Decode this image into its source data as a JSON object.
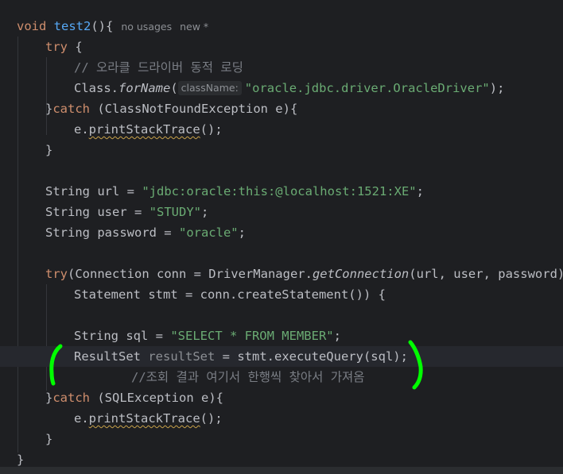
{
  "editor": {
    "method": {
      "kw": "void",
      "name": "test2",
      "rest": "(){",
      "usages": "no usages",
      "author": "new *"
    },
    "try1": {
      "kw": "try",
      "rest": " {"
    },
    "comment1": "// 오라클 드라이버 동적 로딩",
    "class_for_name": {
      "obj": "Class.",
      "method": "forName",
      "open": "(",
      "hint": "className:",
      "arg": "\"oracle.jdbc.driver.OracleDriver\"",
      "close": ");"
    },
    "catch1": {
      "brace": "}",
      "kw": "catch",
      "rest": " (ClassNotFoundException e){"
    },
    "print1": {
      "obj": "e.",
      "method": "printStackTrace",
      "rest": "();"
    },
    "close1": "}",
    "url_line": {
      "decl": "String url = ",
      "value": "\"jdbc:oracle:this:@localhost:1521:XE\"",
      "end": ";"
    },
    "user_line": {
      "decl": "String user = ",
      "value": "\"STUDY\"",
      "end": ";"
    },
    "pw_line": {
      "decl": "String password = ",
      "value": "\"oracle\"",
      "end": ";"
    },
    "try2": {
      "kw": "try",
      "a": "(Connection conn = DriverManager.",
      "method": "getConnection",
      "b": "(url, user, password);"
    },
    "stmt_line": "Statement stmt = conn.createStatement()) {",
    "sql_line": {
      "decl": "String sql = ",
      "value": "\"SELECT * FROM MEMBER\"",
      "end": ";"
    },
    "rs_line": {
      "type": "ResultSet ",
      "var": "resultSet",
      "rest": " = stmt.executeQuery(sql);"
    },
    "comment2": "//조회 결과 여기서 한행씩 찾아서 가져옴",
    "catch2": {
      "brace": "}",
      "kw": "catch",
      "rest": " (SQLException e){"
    },
    "print2": {
      "obj": "e.",
      "method": "printStackTrace",
      "rest": "();"
    },
    "close2": "}",
    "close3": "}"
  },
  "annotation": {
    "color": "#00ff00"
  }
}
